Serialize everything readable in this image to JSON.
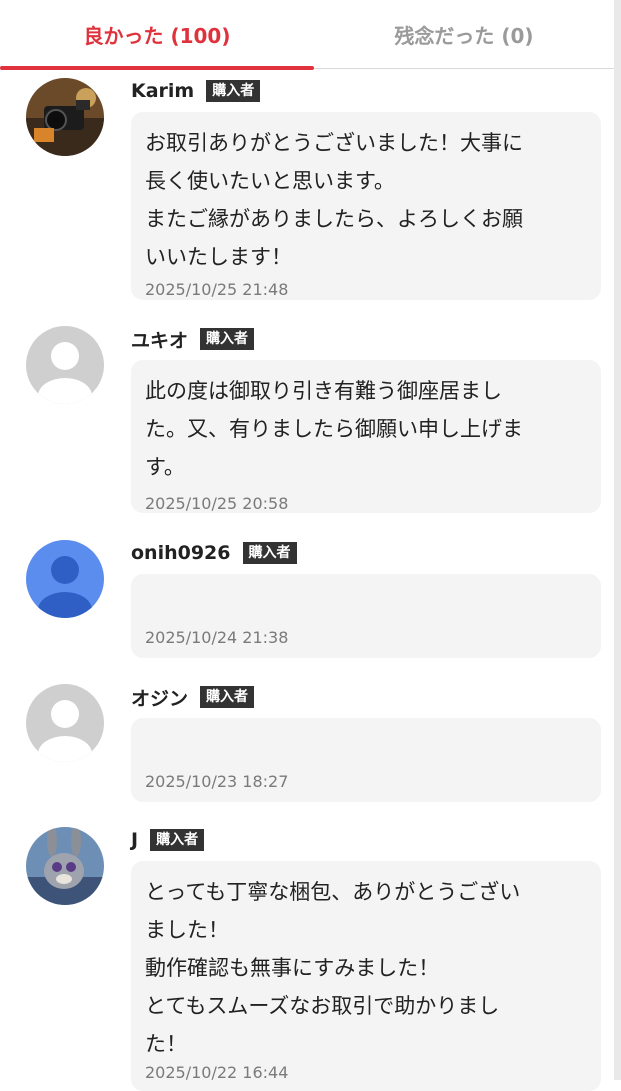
{
  "tabs": {
    "good": "良かった (100)",
    "bad": "残念だった (0)"
  },
  "badge_label": "購入者",
  "reviews": [
    {
      "name": "Karim",
      "comment": "お取引ありがとうございました！大事に\n長く使いたいと思います。\nまたご縁がありましたら、よろしくお願\nいいたします！",
      "date": "2025/10/25 21:48"
    },
    {
      "name": "ユキオ",
      "comment": "此の度は御取り引き有難う御座居まし\nた。又、有りましたら御願い申し上げま\nす。",
      "date": "2025/10/25 20:58"
    },
    {
      "name": "onih0926",
      "comment": "",
      "date": "2025/10/24 21:38"
    },
    {
      "name": "オジン",
      "comment": "",
      "date": "2025/10/23 18:27"
    },
    {
      "name": "J",
      "comment": "とっても丁寧な梱包、ありがとうござい\nました！\n動作確認も無事にすみました！\nとてもスムーズなお取引で助かりまし\nた！",
      "date": "2025/10/22 16:44"
    }
  ],
  "colors": {
    "accent": "#e0323c",
    "inactive_tab": "#9a9a9a",
    "bubble": "#f4f4f4",
    "badge": "#333333"
  },
  "icons": {
    "avatar_1": "photo-avatar-camera",
    "avatar_2": "default-user-icon",
    "avatar_3": "blue-user-icon",
    "avatar_4": "default-user-icon",
    "avatar_5": "photo-avatar-character"
  }
}
